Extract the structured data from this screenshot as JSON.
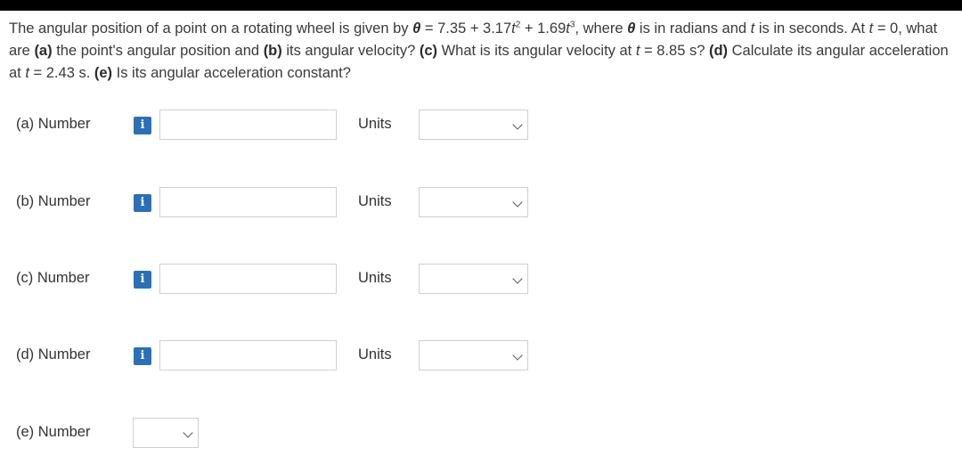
{
  "question": {
    "t1": "The angular position of a point on a rotating wheel is given by ",
    "theta": "θ",
    "eq1": " = 7.35 + 3.17",
    "t": "t",
    "exp2": "2",
    "eq2": " + 1.69",
    "exp3": "3",
    "t2": ", where ",
    "t3": " is in radians and ",
    "t4": " is in seconds. At ",
    "t5": " = 0, what are ",
    "a": "(a)",
    "t6": " the point's angular position and ",
    "b": "(b)",
    "t7": " its angular velocity? ",
    "c": "(c)",
    "t8": " What is its angular velocity at ",
    "t9": " = 8.85 s? ",
    "d": "(d)",
    "t10": " Calculate its angular acceleration at ",
    "t11": " = 2.43 s. ",
    "e": "(e)",
    "t12": " Is its angular acceleration constant?"
  },
  "info_glyph": "i",
  "units_label": "Units",
  "parts": [
    {
      "label": "(a)  Number"
    },
    {
      "label": "(b)  Number"
    },
    {
      "label": "(c)  Number"
    },
    {
      "label": "(d)  Number"
    },
    {
      "label": "(e)  Number"
    }
  ],
  "colors": {
    "info_button": "#2a70b8",
    "field_border": "#cfcfcf",
    "top_bar": "#000000"
  }
}
